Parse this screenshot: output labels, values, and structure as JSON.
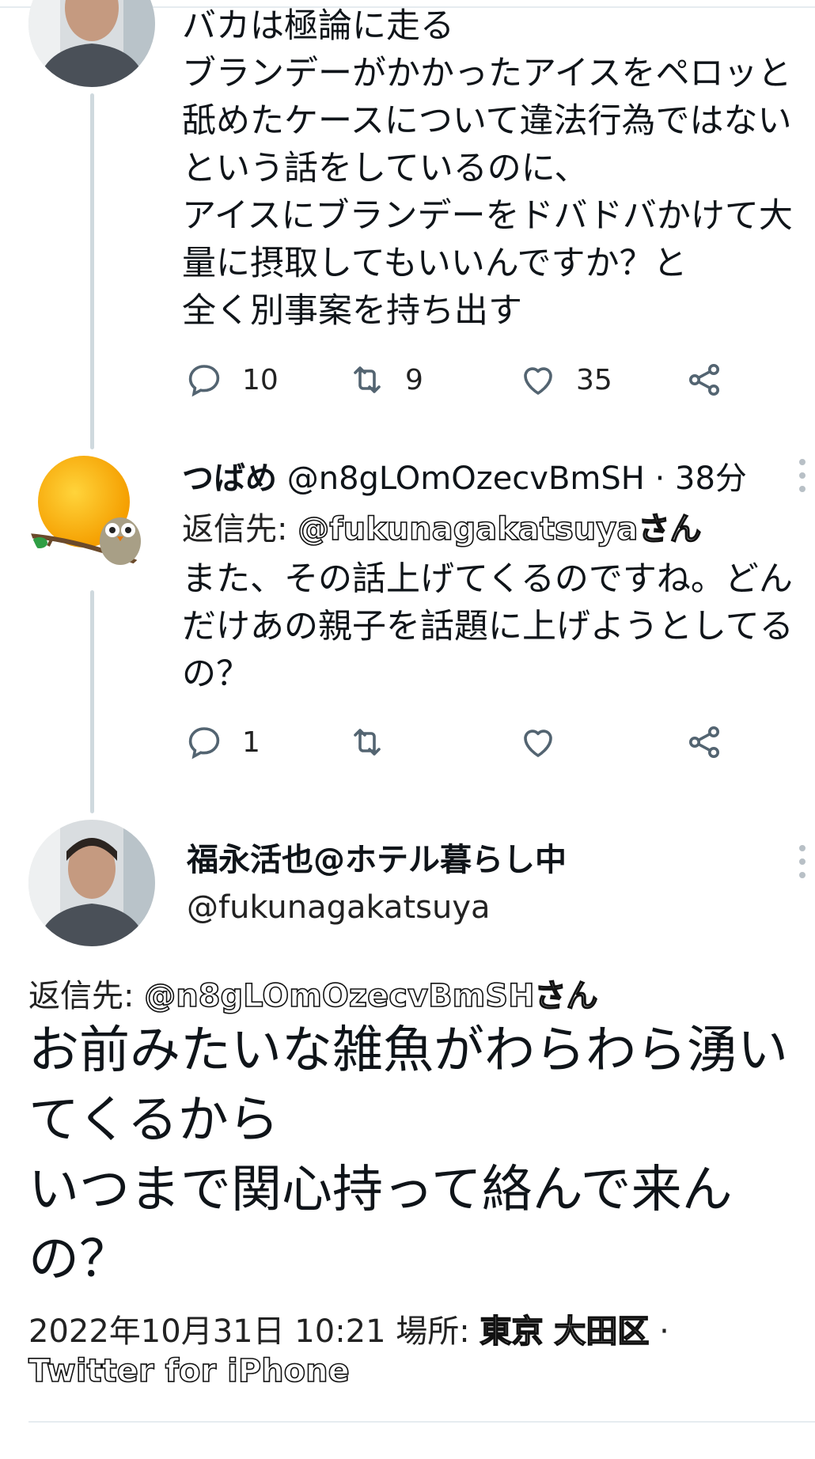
{
  "tweet1": {
    "lines": [
      "バカは極論に走る",
      "ブランデーがかかったアイスをペロッと",
      "舐めたケースについて違法行為ではない",
      "という話をしているのに、",
      "アイスにブランデーをドバドバかけて大",
      "量に摂取してもいいんですか？と",
      "全く別事案を持ち出す"
    ],
    "replies": "10",
    "retweets": "9",
    "likes": "35"
  },
  "tweet2": {
    "display_name": "つばめ",
    "handle_time": "@n8gLOmOzecvBmSH · 38分",
    "reply_label": "返信先: ",
    "reply_to": "@fukunagakatsuyaさん",
    "lines": [
      "また、その話上げてくるのですね。どん",
      "だけあの親子を話題に上げようとしてる",
      "の？"
    ],
    "replies": "1"
  },
  "main": {
    "display_name": "福永活也@ホテル暮らし中",
    "handle": "@fukunagakatsuya",
    "reply_label": "返信先: ",
    "reply_to": "@n8gLOmOzecvBmSHさん",
    "lines": [
      "お前みたいな雑魚がわらわら湧い",
      "てくるから",
      "いつまで関心持って絡んで来ん",
      "の？"
    ],
    "date": "2022年10月31日 10:21 場所: ",
    "location": "東京 大田区",
    "separator": " ·",
    "client": "Twitter for iPhone"
  },
  "icons": [
    "reply-icon",
    "retweet-icon",
    "like-icon",
    "share-icon",
    "more-icon"
  ],
  "colors": {
    "thread_line": "#cfd9de",
    "text": "#0f1419",
    "icon": "#536471"
  }
}
